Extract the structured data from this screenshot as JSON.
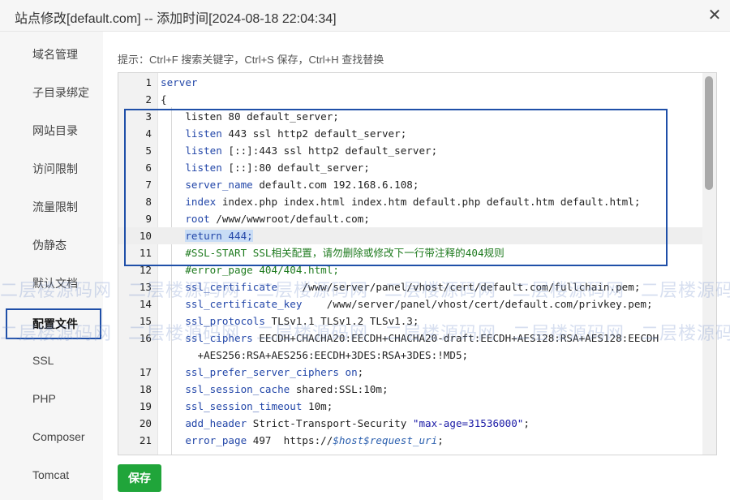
{
  "dialog": {
    "title": "站点修改[default.com] -- 添加时间[2024-08-18 22:04:34]",
    "close_symbol": "✕"
  },
  "sidebar": {
    "items": [
      {
        "label": "域名管理"
      },
      {
        "label": "子目录绑定"
      },
      {
        "label": "网站目录"
      },
      {
        "label": "访问限制"
      },
      {
        "label": "流量限制"
      },
      {
        "label": "伪静态"
      },
      {
        "label": "默认文档"
      },
      {
        "label": "配置文件",
        "active": true
      },
      {
        "label": "SSL"
      },
      {
        "label": "PHP"
      },
      {
        "label": "Composer"
      },
      {
        "label": "Tomcat"
      }
    ]
  },
  "hint": "提示：Ctrl+F 搜索关键字，Ctrl+S 保存，Ctrl+H 查找替换",
  "editor": {
    "highlighted_line": 10,
    "lines": [
      {
        "n": "1",
        "segs": [
          {
            "t": "server",
            "c": "kw"
          }
        ]
      },
      {
        "n": "2",
        "segs": [
          {
            "t": "{"
          }
        ]
      },
      {
        "n": "3",
        "segs": [
          {
            "t": "    listen 80 default_server;"
          }
        ]
      },
      {
        "n": "4",
        "segs": [
          {
            "t": "    "
          },
          {
            "t": "listen",
            "c": "kw"
          },
          {
            "t": " 443 ssl http2 default_server;"
          }
        ]
      },
      {
        "n": "5",
        "segs": [
          {
            "t": "    "
          },
          {
            "t": "listen",
            "c": "kw"
          },
          {
            "t": " [::]:443 ssl http2 default_server;"
          }
        ]
      },
      {
        "n": "6",
        "segs": [
          {
            "t": "    "
          },
          {
            "t": "listen",
            "c": "kw"
          },
          {
            "t": " [::]:80 default_server;"
          }
        ]
      },
      {
        "n": "7",
        "segs": [
          {
            "t": "    "
          },
          {
            "t": "server_name",
            "c": "kw"
          },
          {
            "t": " default.com 192.168.6.108;"
          }
        ]
      },
      {
        "n": "8",
        "segs": [
          {
            "t": "    "
          },
          {
            "t": "index",
            "c": "kw"
          },
          {
            "t": " index.php index.html index.htm default.php default.htm default.html;"
          }
        ]
      },
      {
        "n": "9",
        "segs": [
          {
            "t": "    "
          },
          {
            "t": "root",
            "c": "kw"
          },
          {
            "t": " /www/wwwroot/default.com;"
          }
        ]
      },
      {
        "n": "10",
        "segs": [
          {
            "t": "    "
          },
          {
            "t": "return 444;",
            "c": "kw sel"
          }
        ]
      },
      {
        "n": "11",
        "segs": [
          {
            "t": "    "
          },
          {
            "t": "#SSL-START SSL相关配置，请勿删除或修改下一行带注释的404规则",
            "c": "cmt"
          }
        ]
      },
      {
        "n": "12",
        "segs": [
          {
            "t": "    "
          },
          {
            "t": "#error_page 404/404.html;",
            "c": "cmt"
          }
        ]
      },
      {
        "n": "13",
        "segs": [
          {
            "t": "    "
          },
          {
            "t": "ssl_certificate",
            "c": "kw"
          },
          {
            "t": "    /www/server/panel/vhost/cert/default.com/fullchain.pem;"
          }
        ]
      },
      {
        "n": "14",
        "segs": [
          {
            "t": "    "
          },
          {
            "t": "ssl_certificate_key",
            "c": "kw"
          },
          {
            "t": "    /www/server/panel/vhost/cert/default.com/privkey.pem;"
          }
        ]
      },
      {
        "n": "15",
        "segs": [
          {
            "t": "    "
          },
          {
            "t": "ssl_protocols",
            "c": "kw"
          },
          {
            "t": " TLSv1.1 TLSv1.2 TLSv1.3;"
          }
        ]
      },
      {
        "n": "16",
        "segs": [
          {
            "t": "    "
          },
          {
            "t": "ssl_ciphers",
            "c": "kw"
          },
          {
            "t": " EECDH+CHACHA20:EECDH+CHACHA20-draft:EECDH+AES128:RSA+AES128:EECDH"
          }
        ]
      },
      {
        "n": "",
        "segs": [
          {
            "t": "      +AES256:RSA+AES256:EECDH+3DES:RSA+3DES:!MD5;"
          }
        ]
      },
      {
        "n": "17",
        "segs": [
          {
            "t": "    "
          },
          {
            "t": "ssl_prefer_server_ciphers",
            "c": "kw"
          },
          {
            "t": " "
          },
          {
            "t": "on",
            "c": "kw"
          },
          {
            "t": ";"
          }
        ]
      },
      {
        "n": "18",
        "segs": [
          {
            "t": "    "
          },
          {
            "t": "ssl_session_cache",
            "c": "kw"
          },
          {
            "t": " shared:SSL:10m;"
          }
        ]
      },
      {
        "n": "19",
        "segs": [
          {
            "t": "    "
          },
          {
            "t": "ssl_session_timeout",
            "c": "kw"
          },
          {
            "t": " 10m;"
          }
        ]
      },
      {
        "n": "20",
        "segs": [
          {
            "t": "    "
          },
          {
            "t": "add_header",
            "c": "kw"
          },
          {
            "t": " Strict-Transport-Security "
          },
          {
            "t": "\"max-age=31536000\"",
            "c": "str"
          },
          {
            "t": ";"
          }
        ]
      },
      {
        "n": "21",
        "segs": [
          {
            "t": "    "
          },
          {
            "t": "error_page",
            "c": "kw"
          },
          {
            "t": " 497  https://"
          },
          {
            "t": "$host$request_uri",
            "c": "var"
          },
          {
            "t": ";"
          }
        ]
      }
    ]
  },
  "save_button": {
    "label": "保存"
  },
  "watermark": "二层楼源码网"
}
